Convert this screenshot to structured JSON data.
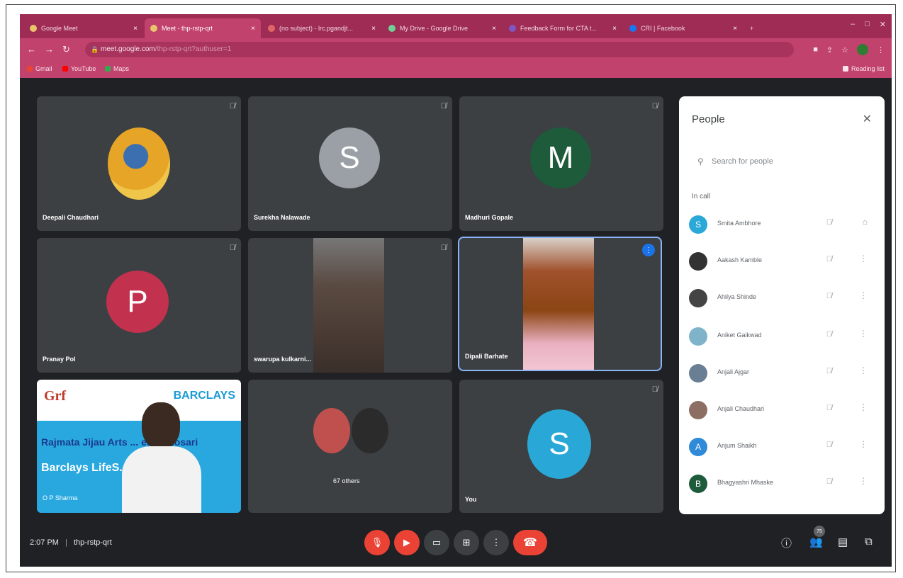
{
  "browser": {
    "tabs": [
      {
        "label": "Google Meet"
      },
      {
        "label": "Meet - thp-rstp-qrt"
      },
      {
        "label": "(no subject) - lrc.pgandjt..."
      },
      {
        "label": "My Drive - Google Drive"
      },
      {
        "label": "Feedback Form for CTA t..."
      },
      {
        "label": "CRI | Facebook"
      }
    ],
    "url_host": "meet.google.com",
    "url_path": "/thp-rstp-qrt?authuser=1",
    "bookmarks": [
      "Gmail",
      "YouTube",
      "Maps"
    ],
    "reading_list": "Reading list"
  },
  "tiles": {
    "t1": {
      "name": "Deepali Chaudhari"
    },
    "t2": {
      "name": "Surekha Nalawade",
      "initial": "S"
    },
    "t3": {
      "name": "Madhuri Gopale",
      "initial": "M"
    },
    "t4": {
      "name": "Pranay Pol",
      "initial": "P"
    },
    "t5": {
      "name": "swarupa kulkarni..."
    },
    "t6": {
      "name": "Dipali Barhate"
    },
    "t7": {
      "logo": "Grf",
      "brand": "BARCLAYS",
      "line1": "Rajmata Jijau Arts ... ege Bhosari",
      "line2": "Barclays LifeS... rogramme",
      "caption": "O P Sharma"
    },
    "t8": {
      "name": "67 others"
    },
    "t9": {
      "name": "You",
      "initial": "S"
    }
  },
  "people_panel": {
    "title": "People",
    "search_placeholder": "Search for people",
    "section": "In call",
    "members": [
      {
        "initial": "S",
        "name": "Smita Ambhore",
        "color": "#2aa8d8"
      },
      {
        "initial": "",
        "name": "Aakash Kamble",
        "color": "#333333"
      },
      {
        "initial": "",
        "name": "Ahilya Shinde",
        "color": "#444444"
      },
      {
        "initial": "",
        "name": "Aniket Gaikwad",
        "color": "#7fb3c9"
      },
      {
        "initial": "",
        "name": "Anjali Ajgar",
        "color": "#6a7e94"
      },
      {
        "initial": "",
        "name": "Anjali Chaudhari",
        "color": "#8d6e63"
      },
      {
        "initial": "A",
        "name": "Anjum Shaikh",
        "color": "#2f8ad8"
      },
      {
        "initial": "B",
        "name": "Bhagyashri Mhaske",
        "color": "#1e5b3a"
      }
    ]
  },
  "bottom_bar": {
    "time": "2:07 PM",
    "separator": "|",
    "meeting_code": "thp-rstp-qrt",
    "participant_count": "75"
  },
  "colors": {
    "chrome_dark": "#9e2c55",
    "chrome": "#c2426e",
    "meet_bg": "#202124",
    "tile_bg": "#3c4043",
    "end_call": "#ea4335",
    "active_outline": "#8ab4f8"
  }
}
